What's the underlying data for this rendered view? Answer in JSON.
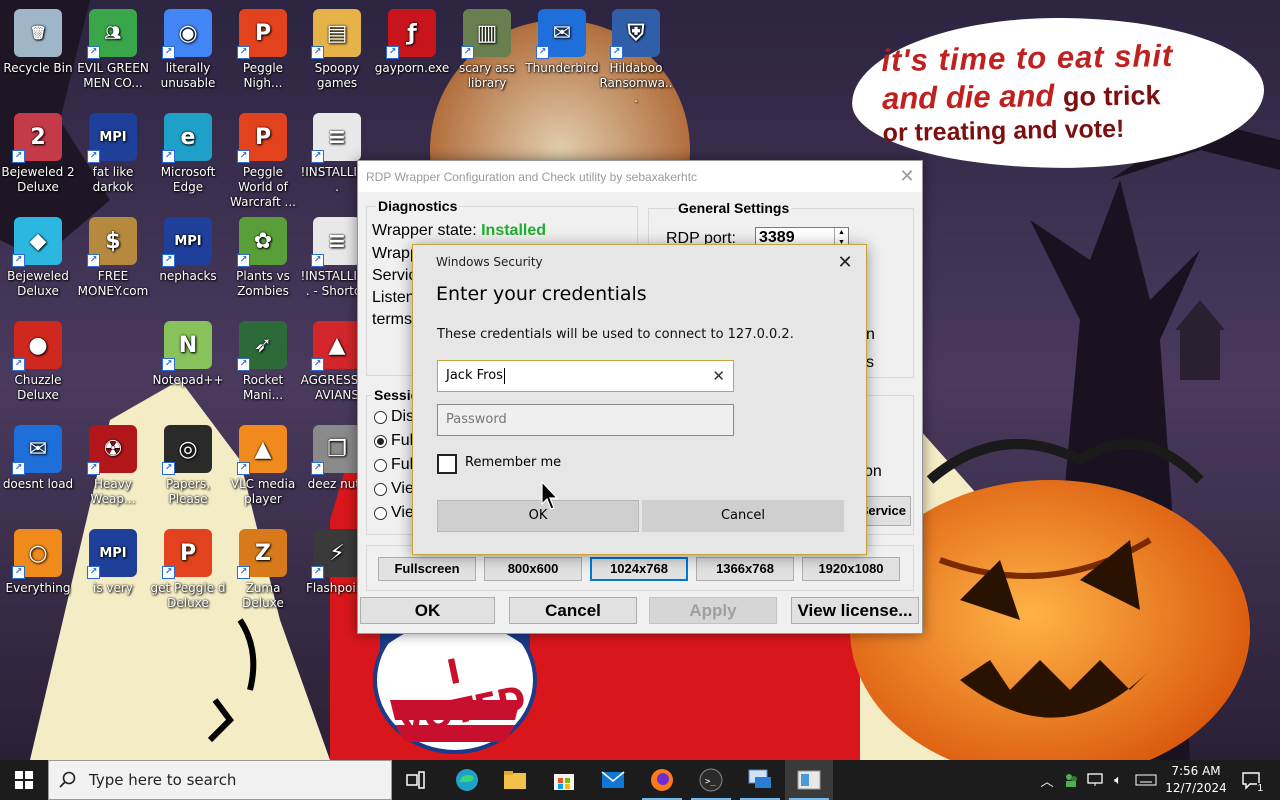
{
  "desktop": {
    "icons": [
      {
        "label": "Recycle Bin",
        "icon": "recycle-bin-icon"
      },
      {
        "label": "EVIL GREEN MEN CO...",
        "icon": "people-icon"
      },
      {
        "label": "literally unusable",
        "icon": "chrome-icon"
      },
      {
        "label": "Peggle Nigh...",
        "icon": "peggle-icon"
      },
      {
        "label": "Spoopy games",
        "icon": "folder-icon"
      },
      {
        "label": "gayporn.exe",
        "icon": "flash-icon"
      },
      {
        "label": "scary ass library",
        "icon": "library-icon"
      },
      {
        "label": "Thunderbird",
        "icon": "thunderbird-icon"
      },
      {
        "label": "Hildaboo Ransomwa...",
        "icon": "shield-icon"
      },
      {
        "label": "Bejeweled 2 Deluxe",
        "icon": "gem-icon"
      },
      {
        "label": "fat like darkok",
        "icon": "mpi-icon"
      },
      {
        "label": "Microsoft Edge",
        "icon": "edge-icon"
      },
      {
        "label": "Peggle World of Warcraft ...",
        "icon": "peggle-icon"
      },
      {
        "label": "!INSTALLIN...",
        "icon": "document-icon"
      },
      {
        "label": "Bejeweled Deluxe",
        "icon": "diamond-icon"
      },
      {
        "label": "FREE MONEY.com",
        "icon": "money-bag-icon"
      },
      {
        "label": "nephacks",
        "icon": "mpi-icon"
      },
      {
        "label": "Plants vs Zombies",
        "icon": "plant-icon"
      },
      {
        "label": "!INSTALLIN... - Shortcu",
        "icon": "document-icon"
      },
      {
        "label": "Chuzzle Deluxe",
        "icon": "chuzzle-icon"
      },
      {
        "label": "Notepad++",
        "icon": "notepad-icon"
      },
      {
        "label": "Rocket Mani...",
        "icon": "rocket-icon"
      },
      {
        "label": "AGGRESSI... AVIANS",
        "icon": "angry-bird-icon"
      },
      {
        "label": "doesnt load",
        "icon": "thunderbird-icon"
      },
      {
        "label": "Heavy Weap...",
        "icon": "radiation-icon"
      },
      {
        "label": "Papers, Please",
        "icon": "papers-please-icon"
      },
      {
        "label": "VLC media player",
        "icon": "vlc-icon"
      },
      {
        "label": "deez nuts",
        "icon": "windows-stack-icon"
      },
      {
        "label": "Everything",
        "icon": "magnifier-icon"
      },
      {
        "label": "is very",
        "icon": "mpi-icon"
      },
      {
        "label": "get Peggle d Deluxe",
        "icon": "peggle-icon"
      },
      {
        "label": "Zuma Deluxe",
        "icon": "zuma-icon"
      },
      {
        "label": "Flashpoint",
        "icon": "flashpoint-icon"
      }
    ]
  },
  "bubble": {
    "line1": "it's time to eat shit",
    "line2a": "and die and",
    "line2b": "go trick",
    "line3": "or treating and vote!"
  },
  "sticker": {
    "text": "I VOTED"
  },
  "rdp_window": {
    "title": "RDP Wrapper Configuration and Check utility by sebaxakerhtc",
    "diagnostics": {
      "title": "Diagnostics",
      "state_label": "Wrapper state:",
      "state_value": "Installed",
      "line2": "Wrapp",
      "line3": "Servic",
      "line4": "Listen",
      "line5": "terms"
    },
    "general": {
      "title": "General Settings",
      "port_label": "RDP port:",
      "port_value": "3389",
      "partial1": "n",
      "partial2": "s",
      "partial3": "on"
    },
    "session": {
      "title": "Sessio",
      "options": [
        "Dis",
        "Ful",
        "Ful",
        "Vie",
        "Vie"
      ],
      "selected": 1
    },
    "service_btn": "Service",
    "resolutions": [
      "Fullscreen",
      "800x600",
      "1024x768",
      "1366x768",
      "1920x1080"
    ],
    "buttons": {
      "ok": "OK",
      "cancel": "Cancel",
      "apply": "Apply",
      "license": "View license..."
    }
  },
  "security_dialog": {
    "window_title": "Windows Security",
    "heading": "Enter your credentials",
    "description": "These credentials will be used to connect to 127.0.0.2.",
    "username_value": "Jack Fros",
    "password_placeholder": "Password",
    "remember_label": "Remember me",
    "remember_checked": false,
    "ok_label": "OK",
    "cancel_label": "Cancel"
  },
  "taskbar": {
    "search_placeholder": "Type here to search",
    "time": "7:56 AM",
    "date": "12/7/2024",
    "notification_count": "1",
    "apps": [
      "task-view-icon",
      "edge-icon",
      "file-explorer-icon",
      "store-icon",
      "mail-icon",
      "firefox-icon",
      "terminal-icon",
      "remote-desktop-icon",
      "rdp-config-icon"
    ]
  }
}
